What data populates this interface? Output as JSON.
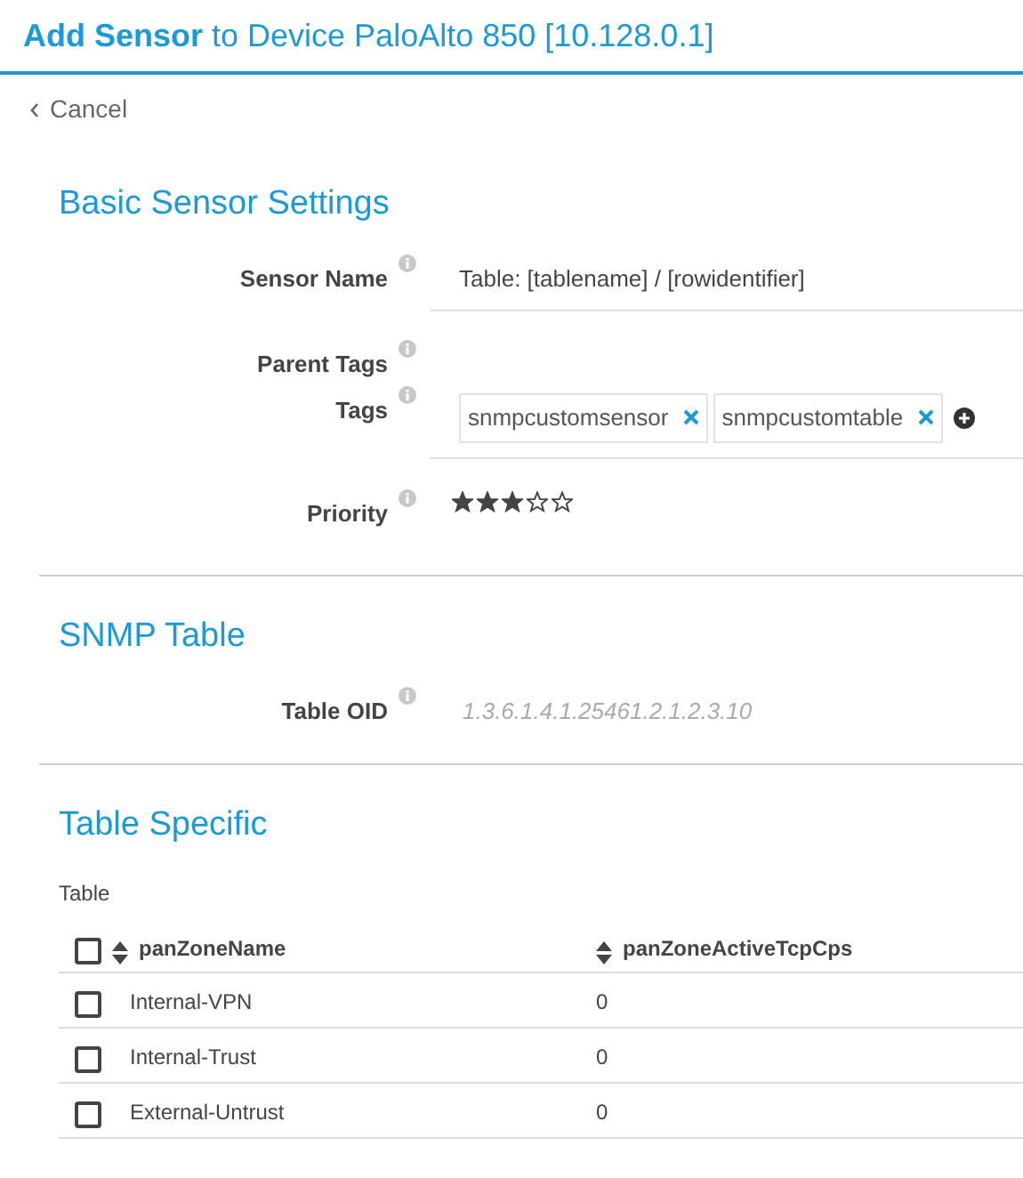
{
  "header": {
    "title": "**Add Sensor** to Device PaloAlto 850 [10.128.0.1]"
  },
  "cancel": {
    "label": "Cancel"
  },
  "basic": {
    "heading": "Basic Sensor Settings",
    "sensor_name": {
      "label": "Sensor Name",
      "value": "Table: [tablename] / [rowidentifier]"
    },
    "parent_tags": {
      "label": "Parent Tags"
    },
    "tags": {
      "label": "Tags",
      "items": [
        "snmpcustomsensor",
        "snmpcustomtable"
      ]
    },
    "priority": {
      "label": "Priority",
      "stars": 3
    }
  },
  "snmp": {
    "heading": "SNMP Table",
    "table_oid": {
      "label": "Table OID",
      "value": "1.3.6.1.4.1.25461.2.1.2.3.10"
    }
  },
  "specific": {
    "heading": "Table Specific",
    "table_label": "Table",
    "table": {
      "select_all_checked": false,
      "columns": [
        "panZoneName",
        "panZoneActiveTcpCps"
      ],
      "rows": [
        {
          "checked": false,
          "cells": [
            "Internal-VPN",
            "0"
          ]
        },
        {
          "checked": false,
          "cells": [
            "Internal-Trust",
            "0"
          ]
        },
        {
          "checked": false,
          "cells": [
            "External-Untrust",
            "0"
          ]
        }
      ]
    }
  }
}
